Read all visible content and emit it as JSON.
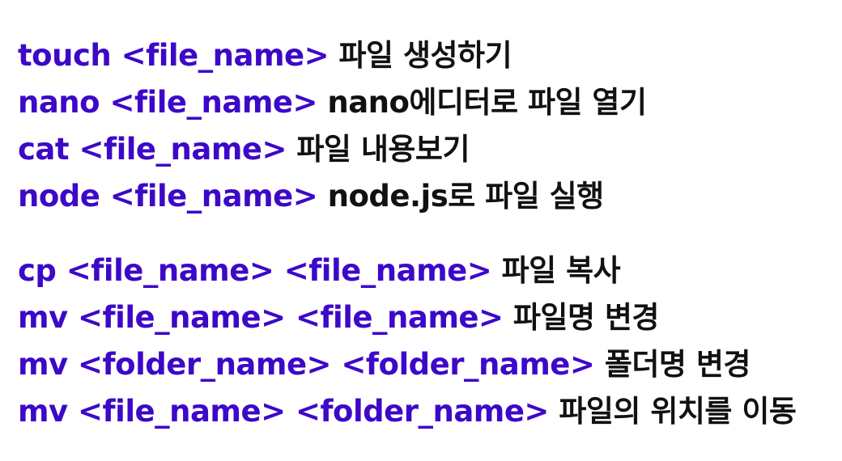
{
  "colors": {
    "command": "#3d08c8",
    "description": "#111111",
    "background": "#ffffff"
  },
  "groups": [
    {
      "lines": [
        {
          "command": "touch <file_name>",
          "description": "파일 생성하기"
        },
        {
          "command": "nano <file_name>",
          "description": "nano에디터로 파일 열기"
        },
        {
          "command": "cat <file_name>",
          "description": "파일 내용보기"
        },
        {
          "command": "node <file_name>",
          "description": "node.js로 파일 실행"
        }
      ]
    },
    {
      "lines": [
        {
          "command": "cp <file_name> <file_name>",
          "description": "파일 복사"
        },
        {
          "command": "mv <file_name> <file_name>",
          "description": "파일명 변경"
        },
        {
          "command": "mv <folder_name> <folder_name>",
          "description": "폴더명 변경"
        },
        {
          "command": "mv <file_name> <folder_name>",
          "description": "파일의 위치를 이동"
        }
      ]
    }
  ]
}
